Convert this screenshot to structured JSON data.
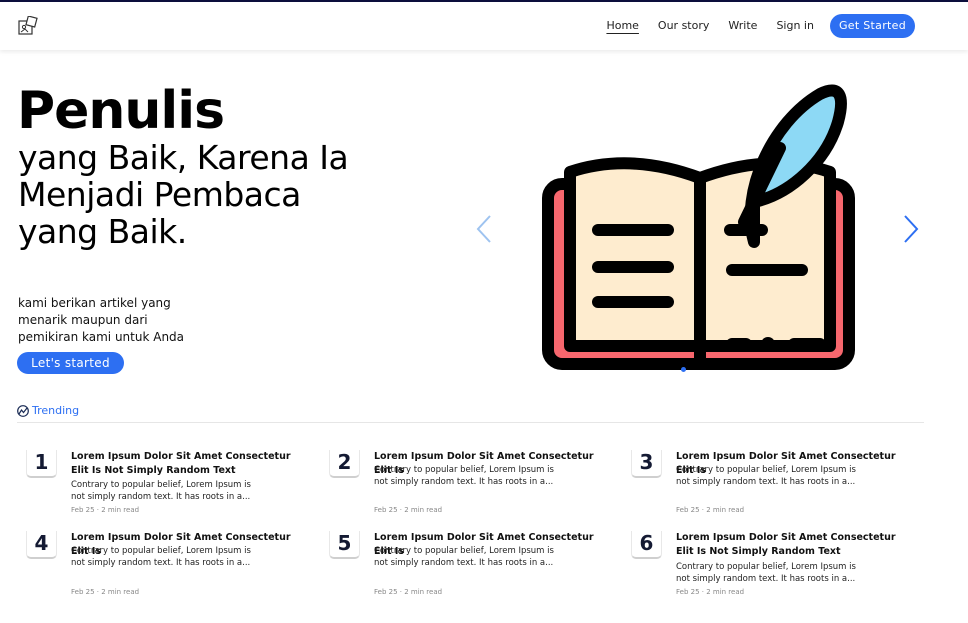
{
  "nav": {
    "links": [
      "Home",
      "Our story",
      "Write",
      "Sign in"
    ],
    "cta": "Get Started",
    "logo_icon": "puzzle-logo-icon"
  },
  "hero": {
    "title": "Penulis",
    "subtitle": "yang Baik, Karena Ia Menjadi Pembaca yang Baik.",
    "description": "kami berikan artikel yang menarik maupun dari pemikiran kami untuk Anda",
    "cta": "Let's started",
    "illustration_icon": "book-quill-icon",
    "prev_icon": "chevron-left-icon",
    "next_icon": "chevron-right-icon"
  },
  "trending": {
    "label": "Trending",
    "icon": "trending-icon"
  },
  "articles": [
    {
      "num": "1",
      "title": "Lorem Ipsum Dolor Sit Amet Consectetur Elit Is Not Simply Random Text",
      "excerpt": "Contrary to popular belief, Lorem Ipsum is not simply random text. It has roots in a...",
      "meta": "Feb 25 · 2 min read"
    },
    {
      "num": "2",
      "title": "Lorem Ipsum Dolor Sit Amet Consectetur Elit Is",
      "excerpt": "Contrary to popular belief, Lorem Ipsum is not simply random text. It has roots in a...",
      "meta": "Feb 25 · 2 min read"
    },
    {
      "num": "3",
      "title": "Lorem Ipsum Dolor Sit Amet Consectetur Elit Is",
      "excerpt": "Contrary to popular belief, Lorem Ipsum is not simply random text. It has roots in a...",
      "meta": "Feb 25 · 2 min read"
    },
    {
      "num": "4",
      "title": "Lorem Ipsum Dolor Sit Amet Consectetur Elit Is",
      "excerpt": "Contrary to popular belief, Lorem Ipsum is not simply random text. It has roots in a...",
      "meta": "Feb 25 · 2 min read"
    },
    {
      "num": "5",
      "title": "Lorem Ipsum Dolor Sit Amet Consectetur Elit Is",
      "excerpt": "Contrary to popular belief, Lorem Ipsum is not simply random text. It has roots in a...",
      "meta": "Feb 25 · 2 min read"
    },
    {
      "num": "6",
      "title": "Lorem Ipsum Dolor Sit Amet Consectetur Elit Is Not Simply Random Text",
      "excerpt": "Contrary to popular belief, Lorem Ipsum is not simply random text. It has roots in a...",
      "meta": "Feb 25 · 2 min read"
    }
  ],
  "colors": {
    "accent": "#2d6ff2",
    "topline": "#0d0f3d",
    "book_page": "#feeccf",
    "book_cover": "#f7676e",
    "quill": "#8dd9f5"
  }
}
